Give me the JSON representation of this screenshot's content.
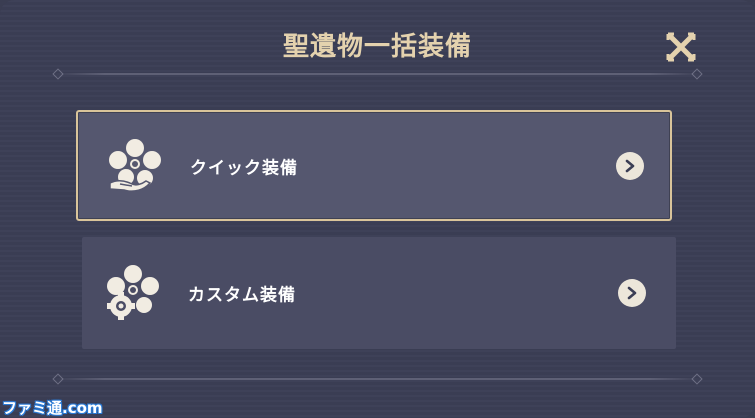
{
  "dialog": {
    "title": "聖遺物一括装備",
    "close_icon": "close-icon"
  },
  "options": [
    {
      "label": "クイック装備",
      "icon": "artifact-flower-hand-icon",
      "selected": true
    },
    {
      "label": "カスタム装備",
      "icon": "artifact-flower-gear-icon",
      "selected": false
    }
  ],
  "watermark": "ファミ通.com",
  "colors": {
    "background": "#3b3e55",
    "title": "#e4d2ae",
    "selected_border": "#d9c49a",
    "option_bg": "#55576f"
  }
}
